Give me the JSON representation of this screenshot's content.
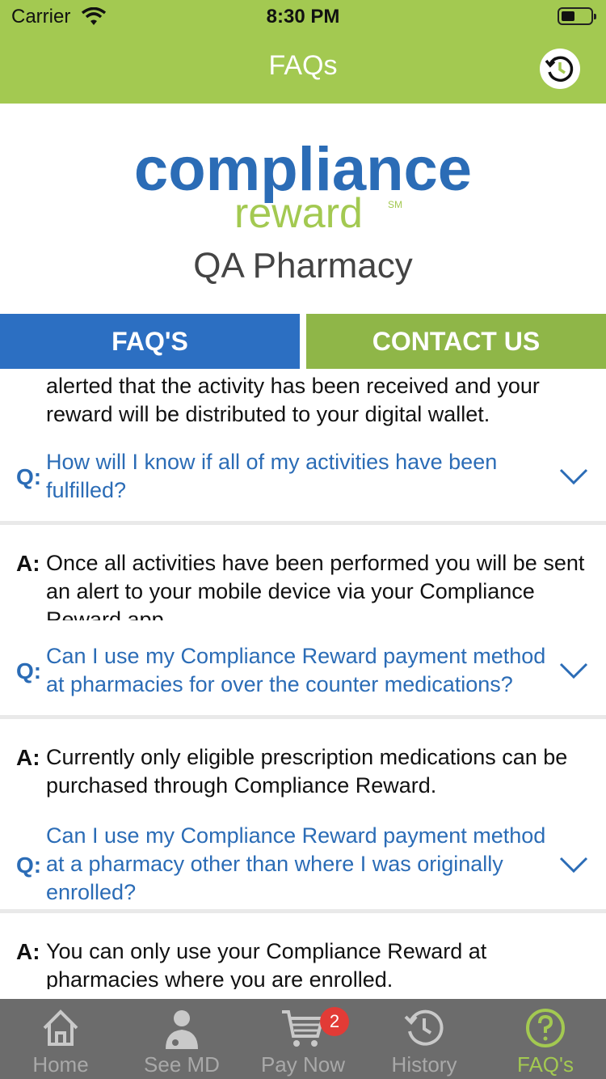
{
  "status_bar": {
    "carrier": "Carrier",
    "time": "8:30 PM"
  },
  "nav": {
    "title": "FAQs"
  },
  "logo": {
    "main": "compliance",
    "sub": "reward",
    "mark": "SM"
  },
  "pharmacy_name": "QA Pharmacy",
  "tabs": [
    {
      "label": "FAQ'S",
      "active": true
    },
    {
      "label": "CONTACT US",
      "active": false
    }
  ],
  "faq": {
    "answer_0": "alerted that the activity has been received and your reward will be distributed to your digital wallet.",
    "items": [
      {
        "q_label": "Q:",
        "question": "How will I know if all of my activities have been fulfilled?",
        "a_label": "A:",
        "answer": "Once all activities have been performed you will be sent an alert to your mobile device via your Compliance Reward app."
      },
      {
        "q_label": "Q:",
        "question": "Can I use my Compliance Reward payment method at pharmacies for over the counter medications?",
        "a_label": "A:",
        "answer": "Currently only eligible prescription medications can be purchased through Compliance Reward."
      },
      {
        "q_label": "Q:",
        "question": "Can I use my Compliance Reward payment method at a pharmacy other than where I was originally enrolled?",
        "a_label": "A:",
        "answer": "You can only use your Compliance Reward at pharmacies where you are enrolled."
      }
    ]
  },
  "tabbar": {
    "items": [
      {
        "label": "Home",
        "icon": "home-icon"
      },
      {
        "label": "See MD",
        "icon": "doctor-icon"
      },
      {
        "label": "Pay Now",
        "icon": "cart-icon",
        "badge": "2"
      },
      {
        "label": "History",
        "icon": "history-icon"
      },
      {
        "label": "FAQ's",
        "icon": "question-icon",
        "active": true
      }
    ]
  },
  "colors": {
    "header": "#a3c951",
    "brand_blue": "#2b6cb6",
    "tab_active": "#2c6fc2",
    "tab_inactive": "#8fb648",
    "tabbar": "#6c6c6c",
    "badge": "#e23b36"
  }
}
